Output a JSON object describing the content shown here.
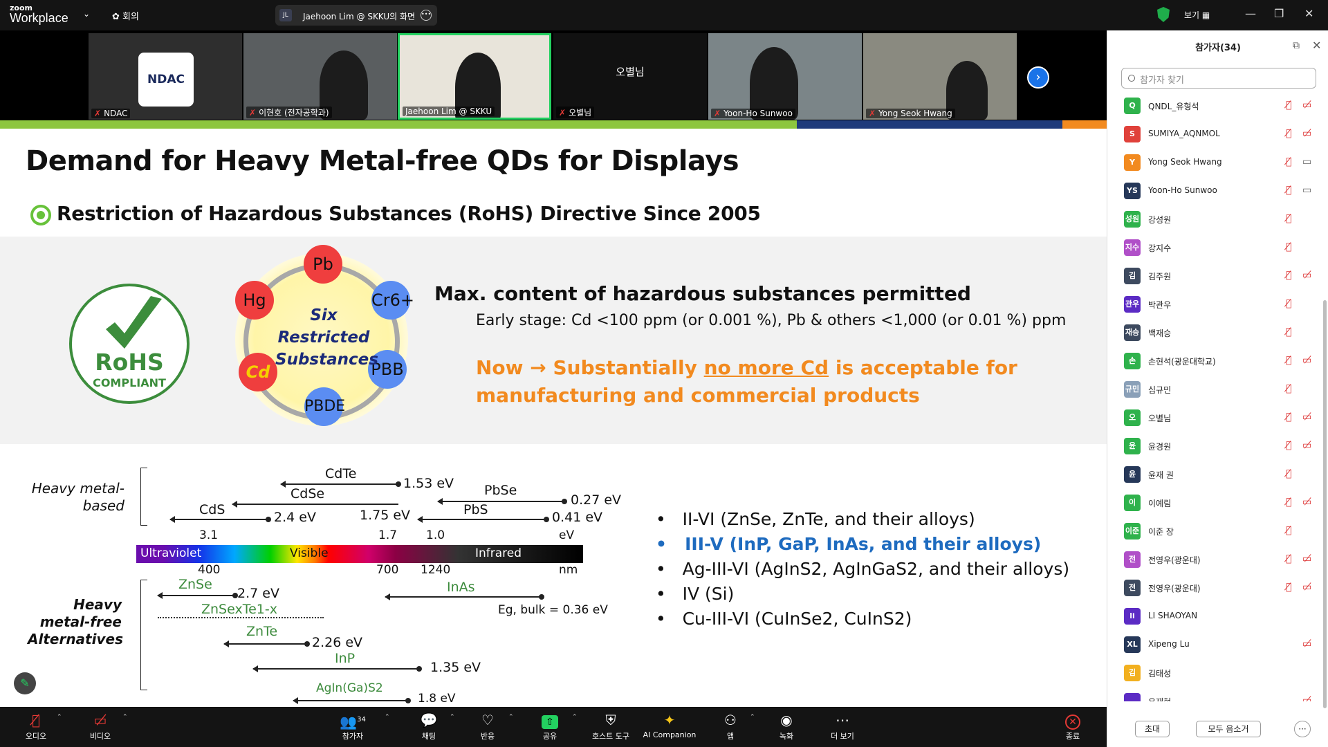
{
  "topbar": {
    "logo_small": "zoom",
    "logo_big": "Workplace",
    "meeting_label": "회의",
    "share_initials": "JL",
    "share_label": "Jaehoon Lim @ SKKU의 화면",
    "view_label": "보기"
  },
  "videos": [
    {
      "name": "NDAC",
      "logo_text": "NDAC"
    },
    {
      "name": "이현호 (전자공학과)"
    },
    {
      "name": "Jaehoon Lim @ SKKU"
    },
    {
      "name": "오별님",
      "center": "오별님"
    },
    {
      "name": "Yoon-Ho Sunwoo"
    },
    {
      "name": "Yong Seok Hwang"
    }
  ],
  "slide": {
    "title": "Demand for Heavy Metal-free QDs for Displays",
    "subtitle": "Restriction of Hazardous Substances (RoHS) Directive Since 2005",
    "rohs_big": "RoHS",
    "rohs_small": "COMPLIANT",
    "elements": [
      "Pb",
      "Cr6+",
      "PBB",
      "PBDE",
      "Cd",
      "Hg"
    ],
    "six_text": "Six Restricted Substances",
    "max_heading": "Max. content of hazardous substances permitted",
    "early_stage": "Early stage: Cd <100 ppm (or 0.001 %), Pb & others <1,000 (or 0.01 %) ppm",
    "now_prefix": "Now",
    "now_mid": "Substantially",
    "now_underline": "no more Cd",
    "now_rest": "is acceptable for",
    "now_line2": "manufacturing and commercial products",
    "heavy_label": "Heavy metal-based",
    "free_label": "Heavy metal-free Alternatives",
    "diagram": {
      "cdte": "CdTe",
      "cdte_ev": "1.53 eV",
      "cdse": "CdSe",
      "cdse_ev": "1.75 eV",
      "cds": "CdS",
      "cds_ev": "2.4 eV",
      "pbse": "PbSe",
      "pbse_ev": "0.27 eV",
      "pbs": "PbS",
      "pbs_ev": "0.41 eV",
      "ev_ticks": [
        "3.1",
        "1.7",
        "1.0",
        "eV"
      ],
      "nm_ticks": [
        "400",
        "700",
        "1240",
        "nm"
      ],
      "spectrum": [
        "Ultraviolet",
        "Visible",
        "Infrared"
      ],
      "znse": "ZnSe",
      "znse_ev": "2.7 eV",
      "znsete": "ZnSexTe1-x",
      "znte": "ZnTe",
      "znte_ev": "2.26 eV",
      "inp": "InP",
      "inp_ev": "1.35 eV",
      "inas": "InAs",
      "inas_ev": "Eg, bulk = 0.36 eV",
      "agin": "AgIn(Ga)S2",
      "agin_ev": "1.8 eV"
    },
    "bullets": [
      "II-VI (ZnSe, ZnTe, and their alloys)",
      "III-V (InP, GaP, InAs, and their alloys)",
      "Ag-III-VI (AgInS2, AgInGaS2, and their alloys)",
      "IV (Si)",
      "Cu-III-VI (CuInSe2, CuInS2)"
    ]
  },
  "panel": {
    "title": "참가자(34)",
    "search_placeholder": "참가자 찾기",
    "participants": [
      {
        "av": "Q",
        "color": "#2fb24c",
        "name": "QNDL_유형석",
        "mic": "off",
        "vid": "off"
      },
      {
        "av": "S",
        "color": "#e0413a",
        "name": "SUMIYA_AQNMOL",
        "mic": "off",
        "vid": "off"
      },
      {
        "av": "Y",
        "color": "#f28a1f",
        "name": "Yong Seok Hwang",
        "mic": "off",
        "vid": "on"
      },
      {
        "av": "YS",
        "color": "#263859",
        "name": "Yoon-Ho Sunwoo",
        "mic": "off",
        "vid": "on"
      },
      {
        "av": "성원",
        "color": "#2fb24c",
        "name": "강성원",
        "mic": "off",
        "vid": ""
      },
      {
        "av": "지수",
        "color": "#b04fc8",
        "name": "강지수",
        "mic": "off",
        "vid": ""
      },
      {
        "av": "김",
        "color": "#3d4a5f",
        "name": "김주원",
        "mic": "off",
        "vid": "off"
      },
      {
        "av": "관우",
        "color": "#5b2bc4",
        "name": "박관우",
        "mic": "off",
        "vid": ""
      },
      {
        "av": "재승",
        "color": "#3d4a5f",
        "name": "백재승",
        "mic": "off",
        "vid": ""
      },
      {
        "av": "손",
        "color": "#2fb24c",
        "name": "손현석(광운대학교)",
        "mic": "off",
        "vid": "off"
      },
      {
        "av": "규민",
        "color": "#8aa0b8",
        "name": "심규민",
        "mic": "off",
        "vid": ""
      },
      {
        "av": "오",
        "color": "#2fb24c",
        "name": "오별님",
        "mic": "off",
        "vid": "off"
      },
      {
        "av": "윤",
        "color": "#2fb24c",
        "name": "윤경원",
        "mic": "off",
        "vid": "off"
      },
      {
        "av": "윤",
        "color": "#263859",
        "name": "윤재 권",
        "mic": "off",
        "vid": ""
      },
      {
        "av": "이",
        "color": "#2fb24c",
        "name": "이예림",
        "mic": "off",
        "vid": "off"
      },
      {
        "av": "이준",
        "color": "#2fb24c",
        "name": "이준 장",
        "mic": "off",
        "vid": ""
      },
      {
        "av": "전",
        "color": "#b04fc8",
        "name": "전영우(광운대)",
        "mic": "off",
        "vid": "off"
      },
      {
        "av": "전",
        "color": "#3d4a5f",
        "name": "전영우(광운대)",
        "mic": "off",
        "vid": "off"
      },
      {
        "av": "li",
        "color": "#5b2bc4",
        "name": "LI SHAOYAN",
        "mic": "",
        "vid": ""
      },
      {
        "av": "XL",
        "color": "#263859",
        "name": "Xipeng Lu",
        "mic": "",
        "vid": "off"
      },
      {
        "av": "김",
        "color": "#f2b01f",
        "name": "김태성",
        "mic": "",
        "vid": ""
      },
      {
        "av": "",
        "color": "#5b2bc4",
        "name": "우재현",
        "mic": "",
        "vid": "off"
      }
    ],
    "invite": "초대",
    "mute_all": "모두 음소거",
    "more": "···"
  },
  "toolbar": {
    "audio": "오디오",
    "video": "비디오",
    "participants": "참가자",
    "participants_count": "34",
    "chat": "채팅",
    "react": "반응",
    "share": "공유",
    "host": "호스트 도구",
    "ai": "AI Companion",
    "apps": "앱",
    "record": "녹화",
    "more": "더 보기",
    "end": "종료"
  }
}
